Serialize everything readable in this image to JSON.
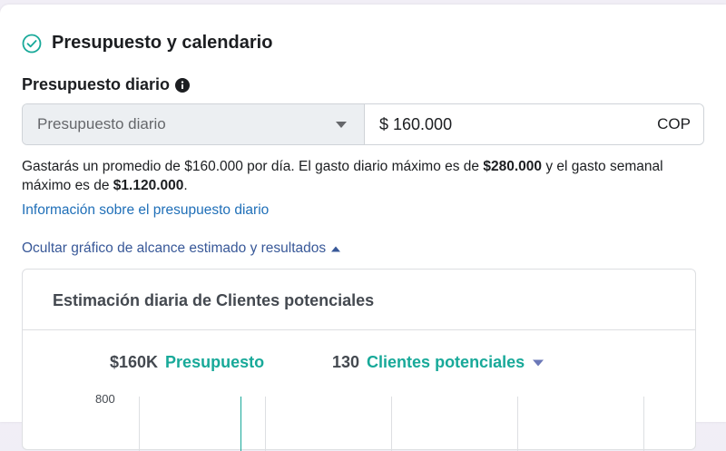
{
  "section": {
    "title": "Presupuesto y calendario"
  },
  "budget": {
    "label": "Presupuesto diario",
    "select_value": "Presupuesto diario",
    "amount": "$ 160.000",
    "currency": "COP"
  },
  "summary": {
    "part1": "Gastarás un promedio de $160.000 por día. El gasto diario máximo es de ",
    "bold1": "$280.000",
    "part2": " y el gasto semanal máximo es de ",
    "bold2": "$1.120.000",
    "part3": "."
  },
  "links": {
    "info": "Información sobre el presupuesto diario",
    "toggle": "Ocultar gráfico de alcance estimado y resultados"
  },
  "chart": {
    "title": "Estimación diaria de Clientes potenciales",
    "budget_value": "$160K",
    "budget_label": "Presupuesto",
    "results_value": "130",
    "results_label": "Clientes potenciales",
    "y_tick": "800"
  },
  "colors": {
    "accent_green": "#18a999",
    "link_blue": "#1f6fb8",
    "toggle_blue": "#385898"
  },
  "icons": {
    "section_status": "check-circle-icon",
    "budget_info": "info-icon",
    "select_caret": "caret-down-icon",
    "toggle_arrow": "caret-up-icon",
    "results_caret": "caret-down-icon"
  }
}
